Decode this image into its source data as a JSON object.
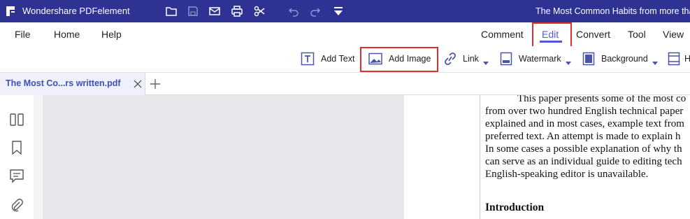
{
  "titlebar": {
    "app_title": "Wondershare PDFelement",
    "doc_title": "The Most Common Habits from more than"
  },
  "menubar": {
    "left_items": [
      {
        "label": "File"
      },
      {
        "label": "Home"
      },
      {
        "label": "Help"
      }
    ],
    "right_items": [
      {
        "label": "Comment"
      },
      {
        "label": "Edit",
        "active": true
      },
      {
        "label": "Convert"
      },
      {
        "label": "Tool"
      },
      {
        "label": "View"
      }
    ]
  },
  "toolbar": {
    "add_text": "Add Text",
    "add_image": "Add Image",
    "link": "Link",
    "watermark": "Watermark",
    "background": "Background",
    "header_footer_partial": "H"
  },
  "tabs": [
    {
      "label": "The Most Co...rs written.pdf",
      "active": true
    }
  ],
  "colors": {
    "titlebar_bg": "#2d3293",
    "accent": "#4f5bd5",
    "highlight_box": "#e0302e",
    "tab_text": "#3f4fb8",
    "canvas_bg": "#e7e7ec"
  },
  "document": {
    "lines": [
      "This paper presents some of the most co",
      "from over two hundred English technical paper",
      "explained and in most cases, example text from",
      "preferred text.  An attempt is made to explain h",
      "In some cases a possible explanation of why th",
      "can serve as an individual guide to editing tech",
      "English-speaking editor is unavailable."
    ],
    "heading": "Introduction"
  }
}
